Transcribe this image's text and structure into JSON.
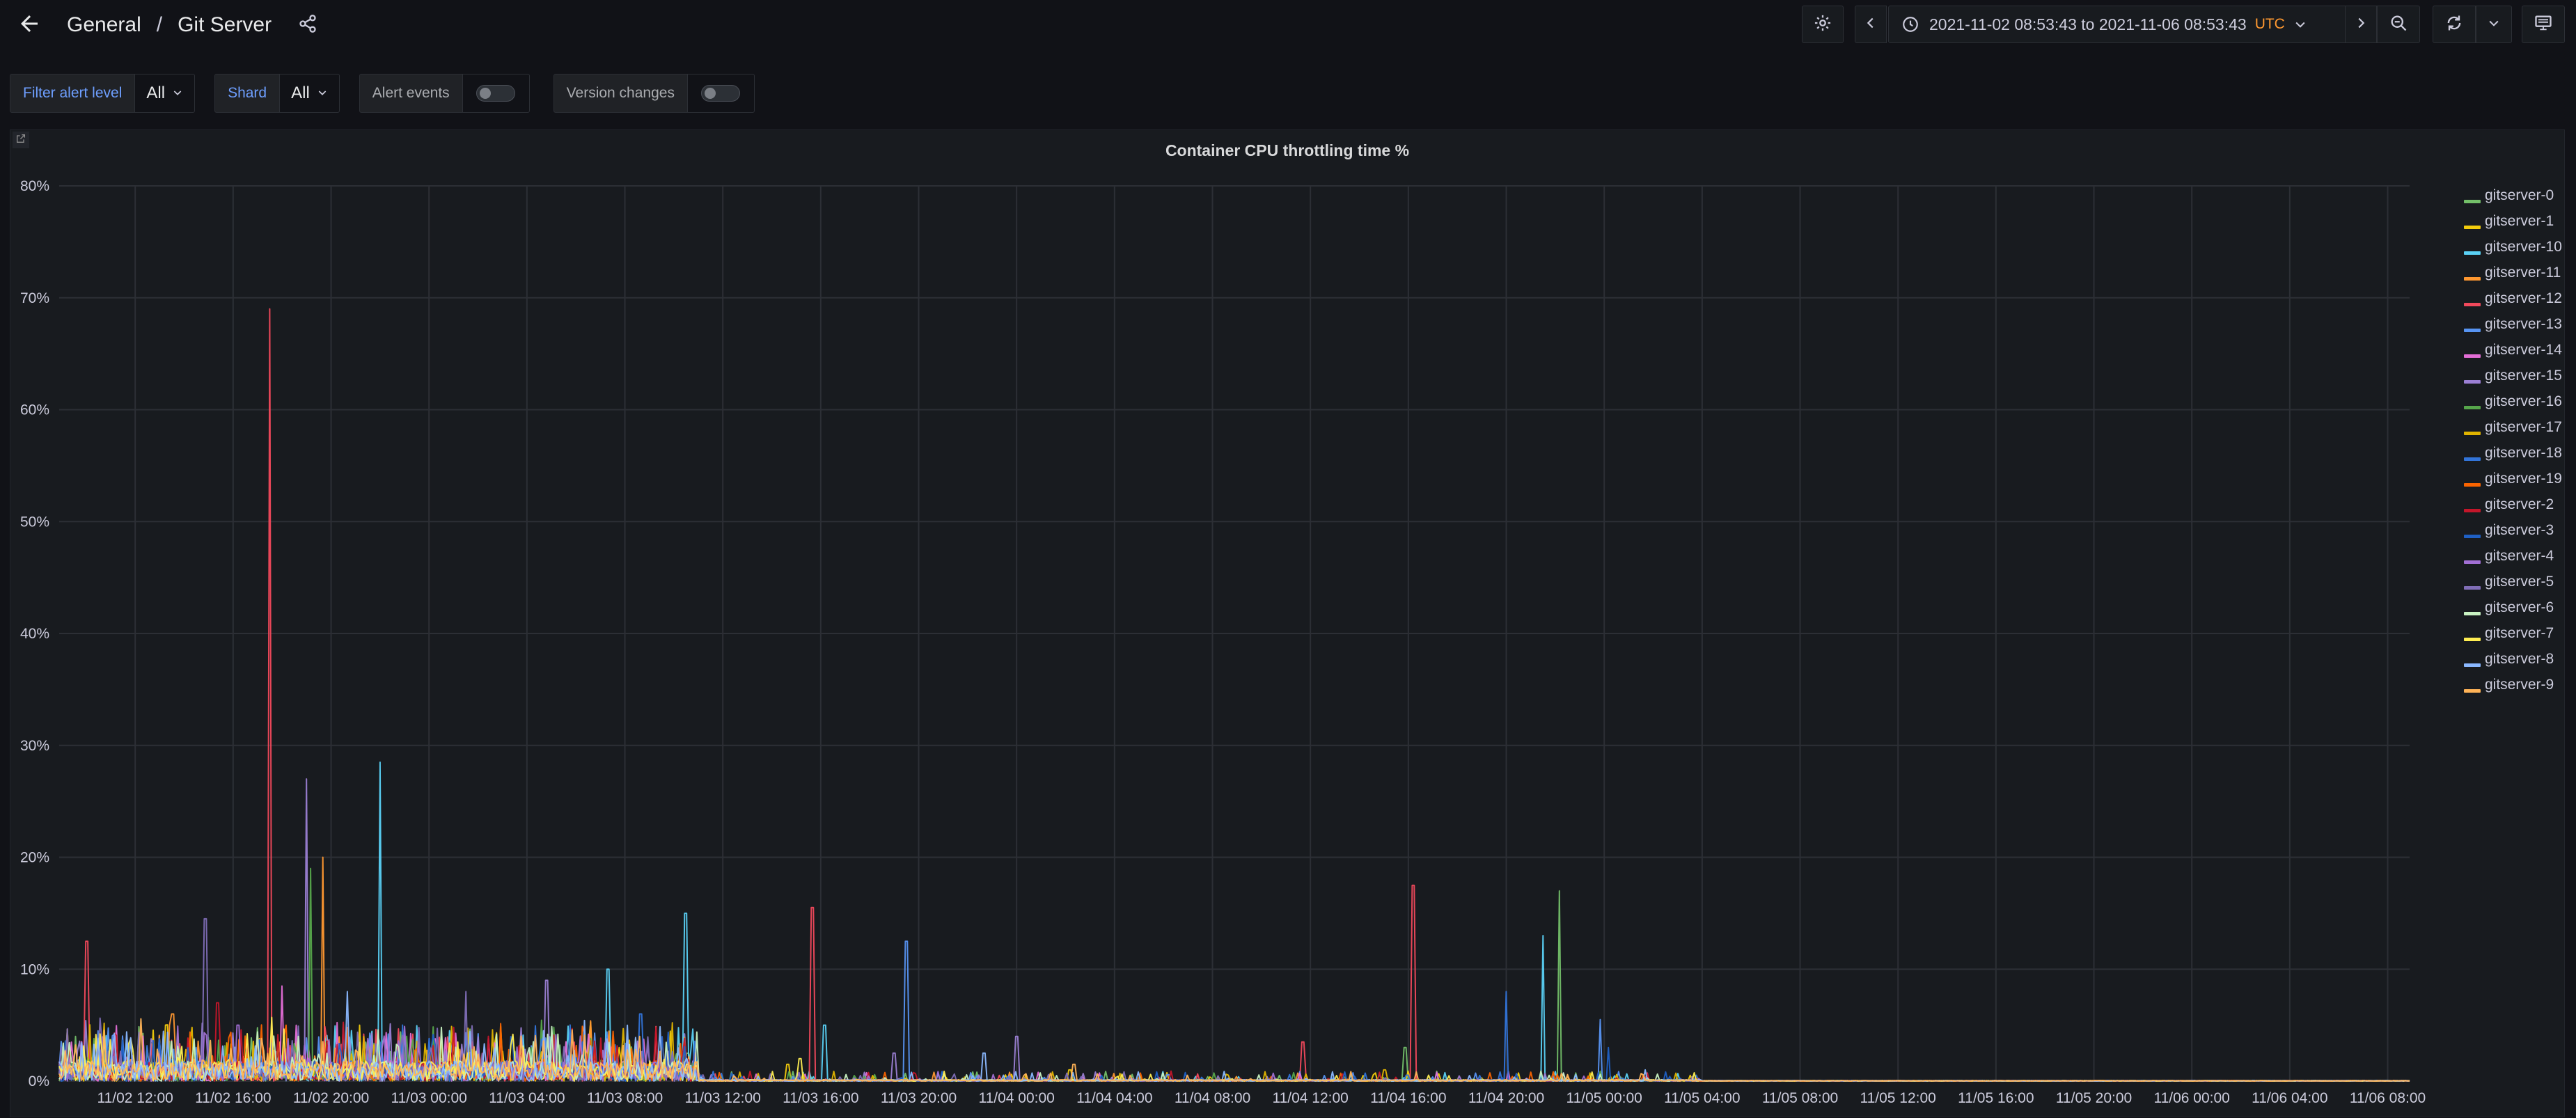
{
  "header": {
    "breadcrumb_folder": "General",
    "breadcrumb_sep": "/",
    "dashboard_title": "Git Server",
    "time_range": "2021-11-02 08:53:43 to 2021-11-06 08:53:43",
    "timezone": "UTC",
    "icons": [
      "arrow-left-icon",
      "share-icon",
      "gear-icon",
      "chevron-left-icon",
      "clock-icon",
      "chevron-down-icon",
      "chevron-right-icon",
      "zoom-out-icon",
      "refresh-icon",
      "chevron-down-icon",
      "monitor-icon"
    ]
  },
  "variables": {
    "filter_alert_level_label": "Filter alert level",
    "filter_alert_level_value": "All",
    "shard_label": "Shard",
    "shard_value": "All",
    "alert_events_label": "Alert events",
    "alert_events_on": false,
    "version_changes_label": "Version changes",
    "version_changes_on": false
  },
  "panel": {
    "title": "Container CPU throttling time %"
  },
  "colors": {
    "background": "#111217",
    "panel": "#181b1f",
    "grid": "#2c2f35",
    "link": "#6e9fff",
    "timezone": "#ff9830"
  },
  "chart_data": {
    "type": "line",
    "title": "Container CPU throttling time %",
    "xlabel": "",
    "ylabel": "",
    "y_unit": "%",
    "ylim": [
      0,
      80
    ],
    "y_ticks": [
      "0%",
      "10%",
      "20%",
      "30%",
      "40%",
      "50%",
      "60%",
      "70%",
      "80%"
    ],
    "x_range": [
      "2021-11-02 08:53:43",
      "2021-11-06 08:53:43"
    ],
    "x_ticks": [
      "11/02 12:00",
      "11/02 16:00",
      "11/02 20:00",
      "11/03 00:00",
      "11/03 04:00",
      "11/03 08:00",
      "11/03 12:00",
      "11/03 16:00",
      "11/03 20:00",
      "11/04 00:00",
      "11/04 04:00",
      "11/04 08:00",
      "11/04 12:00",
      "11/04 16:00",
      "11/04 20:00",
      "11/05 00:00",
      "11/05 04:00",
      "11/05 08:00",
      "11/05 12:00",
      "11/05 16:00",
      "11/05 20:00",
      "11/06 00:00",
      "11/06 04:00",
      "11/06 08:00"
    ],
    "grid": true,
    "legend_position": "right",
    "series": [
      {
        "name": "gitserver-0",
        "color": "#73bf69",
        "peaks": [
          [
            "2021-11-03 00:30",
            2
          ],
          [
            "2021-11-04 15:50",
            3
          ],
          [
            "2021-11-04 22:10",
            17
          ]
        ]
      },
      {
        "name": "gitserver-1",
        "color": "#f2cc0c",
        "peaks": [
          [
            "2021-11-02 21:10",
            5
          ],
          [
            "2021-11-03 14:40",
            1.5
          ],
          [
            "2021-11-04 02:10",
            1
          ]
        ]
      },
      {
        "name": "gitserver-10",
        "color": "#5ad1f5",
        "peaks": [
          [
            "2021-11-02 22:00",
            28.5
          ],
          [
            "2021-11-03 07:20",
            10
          ],
          [
            "2021-11-03 10:30",
            15
          ],
          [
            "2021-11-03 16:10",
            5
          ],
          [
            "2021-11-04 21:30",
            13
          ]
        ]
      },
      {
        "name": "gitserver-11",
        "color": "#ff9830",
        "peaks": [
          [
            "2021-11-02 19:40",
            20
          ],
          [
            "2021-11-02 13:30",
            6
          ]
        ]
      },
      {
        "name": "gitserver-12",
        "color": "#f2495c",
        "peaks": [
          [
            "2021-11-02 10:00",
            12.5
          ],
          [
            "2021-11-02 17:30",
            69
          ],
          [
            "2021-11-03 15:40",
            15.5
          ],
          [
            "2021-11-04 11:40",
            3.5
          ],
          [
            "2021-11-04 16:10",
            17.5
          ]
        ]
      },
      {
        "name": "gitserver-13",
        "color": "#5794f2",
        "peaks": [
          [
            "2021-11-03 19:30",
            12.5
          ],
          [
            "2021-11-04 23:50",
            5.5
          ]
        ]
      },
      {
        "name": "gitserver-14",
        "color": "#e36ed6",
        "peaks": [
          [
            "2021-11-02 18:00",
            8.5
          ]
        ]
      },
      {
        "name": "gitserver-15",
        "color": "#9b7fd4",
        "peaks": [
          [
            "2021-11-02 19:00",
            27
          ],
          [
            "2021-11-03 04:50",
            9
          ],
          [
            "2021-11-03 19:00",
            2.5
          ],
          [
            "2021-11-04 00:00",
            4
          ]
        ]
      },
      {
        "name": "gitserver-16",
        "color": "#56a64b",
        "peaks": [
          [
            "2021-11-02 19:10",
            19
          ]
        ]
      },
      {
        "name": "gitserver-17",
        "color": "#e0b400",
        "peaks": [
          [
            "2021-11-02 21:20",
            4
          ],
          [
            "2021-11-04 15:00",
            1
          ]
        ]
      },
      {
        "name": "gitserver-18",
        "color": "#3274d9",
        "peaks": [
          [
            "2021-11-04 20:00",
            8
          ],
          [
            "2021-11-03 08:40",
            6
          ]
        ]
      },
      {
        "name": "gitserver-19",
        "color": "#fa6400",
        "peaks": [
          [
            "2021-11-02 18:10",
            5
          ]
        ]
      },
      {
        "name": "gitserver-2",
        "color": "#c4162a",
        "peaks": [
          [
            "2021-11-02 15:20",
            7
          ]
        ]
      },
      {
        "name": "gitserver-3",
        "color": "#1f60c4",
        "peaks": [
          [
            "2021-11-05 00:10",
            3
          ]
        ]
      },
      {
        "name": "gitserver-4",
        "color": "#a16fd4",
        "peaks": [
          [
            "2021-11-02 16:10",
            5
          ]
        ]
      },
      {
        "name": "gitserver-5",
        "color": "#806eb7",
        "peaks": [
          [
            "2021-11-02 14:50",
            14.5
          ],
          [
            "2021-11-03 01:30",
            8
          ]
        ]
      },
      {
        "name": "gitserver-6",
        "color": "#c8f2c2",
        "peaks": [
          [
            "2021-11-02 18:40",
            4
          ]
        ]
      },
      {
        "name": "gitserver-7",
        "color": "#ffee52",
        "peaks": [
          [
            "2021-11-03 15:10",
            2
          ]
        ]
      },
      {
        "name": "gitserver-8",
        "color": "#8ab8ff",
        "peaks": [
          [
            "2021-11-02 20:40",
            8
          ],
          [
            "2021-11-03 22:40",
            2.5
          ],
          [
            "2021-11-05 01:40",
            1
          ]
        ]
      },
      {
        "name": "gitserver-9",
        "color": "#ffb357",
        "peaks": [
          [
            "2021-11-04 02:20",
            1.5
          ]
        ]
      }
    ]
  }
}
